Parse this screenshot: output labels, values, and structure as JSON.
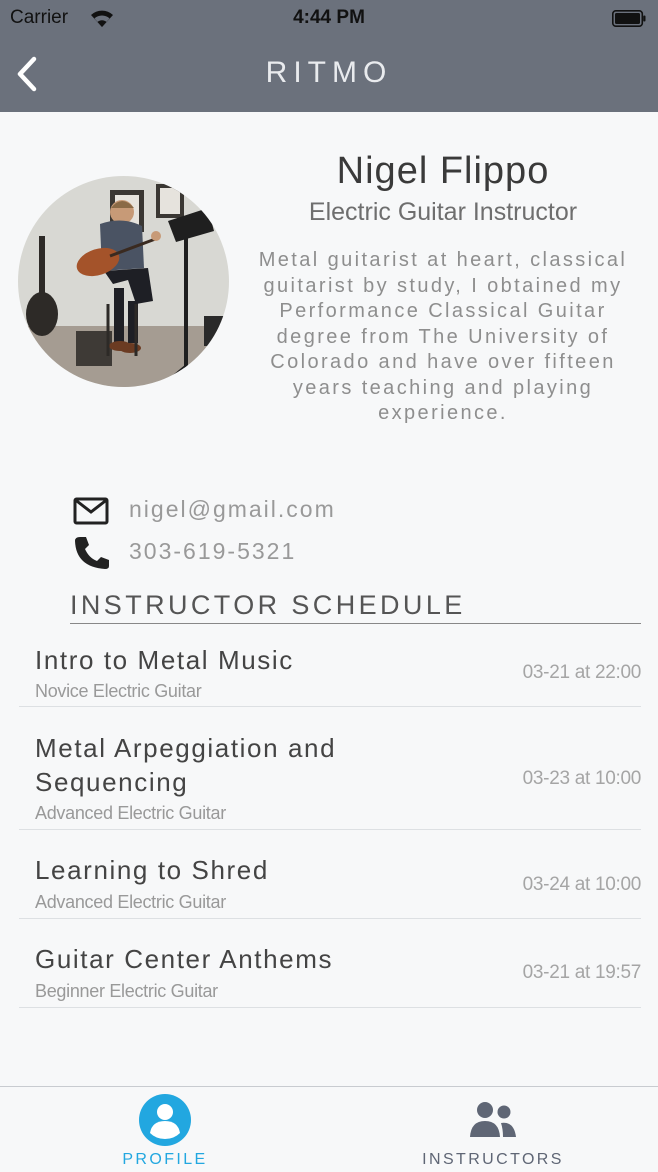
{
  "status_bar": {
    "carrier": "Carrier",
    "time": "4:44 PM"
  },
  "nav": {
    "title": "RITMO",
    "back_icon": "chevron-left-icon"
  },
  "profile": {
    "name": "Nigel Flippo",
    "subtitle": "Electric Guitar Instructor",
    "bio": "Metal guitarist at heart, classical guitarist by study, I obtained my Performance Classical Guitar degree from The University of Colorado and have over fifteen years teaching and playing experience.",
    "email": "nigel@gmail.com",
    "phone": "303-619-5321"
  },
  "schedule": {
    "title": "INSTRUCTOR SCHEDULE",
    "items": [
      {
        "title": "Intro to Metal Music",
        "level": "Novice Electric Guitar",
        "time": "03-21 at 22:00"
      },
      {
        "title": "Metal Arpeggiation and Sequencing",
        "level": "Advanced Electric Guitar",
        "time": "03-23 at 10:00"
      },
      {
        "title": "Learning to Shred",
        "level": "Advanced Electric Guitar",
        "time": "03-24 at 10:00"
      },
      {
        "title": "Guitar Center Anthems",
        "level": "Beginner Electric Guitar",
        "time": "03-21 at 19:57"
      }
    ]
  },
  "tabs": [
    {
      "label": "PROFILE",
      "icon": "profile-icon",
      "active": true
    },
    {
      "label": "INSTRUCTORS",
      "icon": "group-icon",
      "active": false
    }
  ],
  "colors": {
    "nav_background": "#6b717c",
    "accent": "#22a7e0",
    "inactive_tab": "#5f6675",
    "background": "#f7f8f9"
  }
}
